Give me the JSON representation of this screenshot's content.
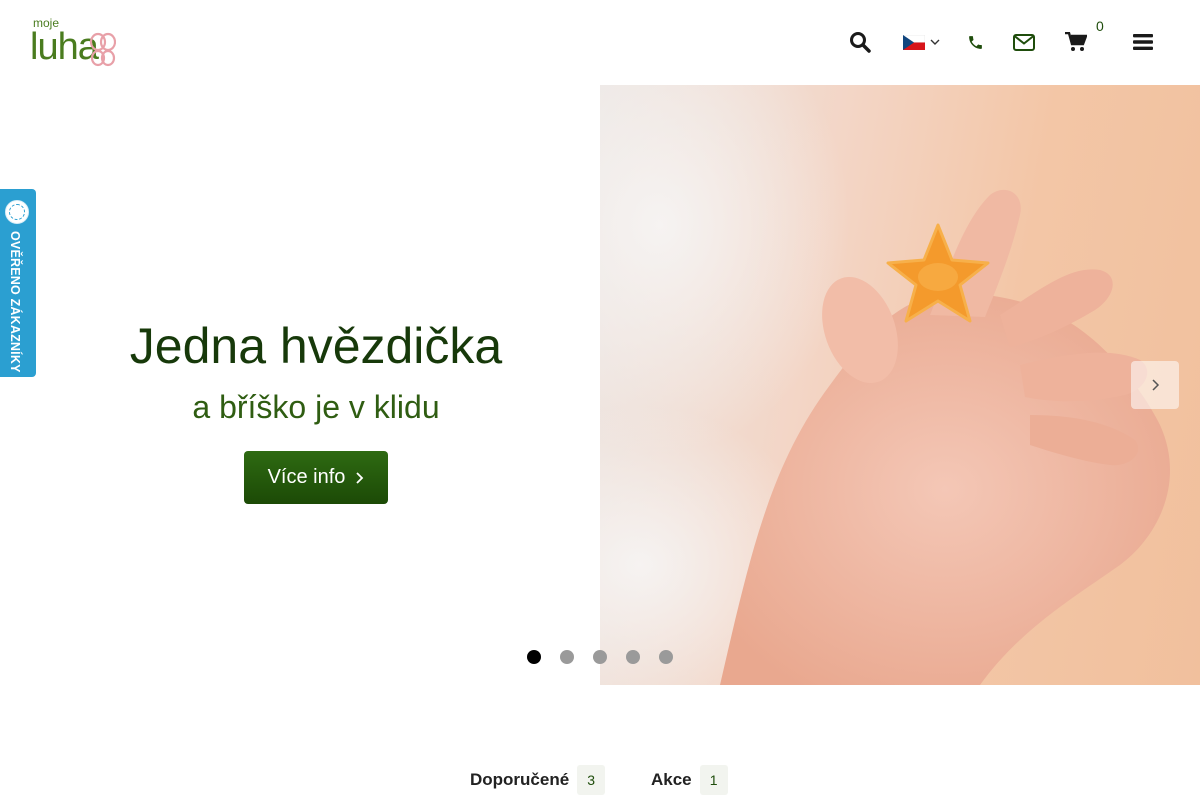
{
  "header": {
    "logo_small": "moje",
    "logo_big": "luha",
    "cart_count": "0"
  },
  "hero": {
    "title": "Jedna hvězdička",
    "subtitle": "a bříško je v klidu",
    "button_label": "Více info",
    "slide_count": 5,
    "active_slide": 1
  },
  "badge": {
    "label": "OVĚŘENO ZÁKAZNÍKY"
  },
  "tabs": [
    {
      "label": "Doporučené",
      "count": "3"
    },
    {
      "label": "Akce",
      "count": "1"
    }
  ],
  "colors": {
    "brand_green": "#2e6a12",
    "badge_blue": "#2b9fd1",
    "title_green": "#17390a"
  },
  "icons": [
    "search-icon",
    "czech-flag-icon",
    "phone-icon",
    "envelope-icon",
    "cart-icon",
    "hamburger-menu-icon",
    "chevron-right-icon"
  ]
}
